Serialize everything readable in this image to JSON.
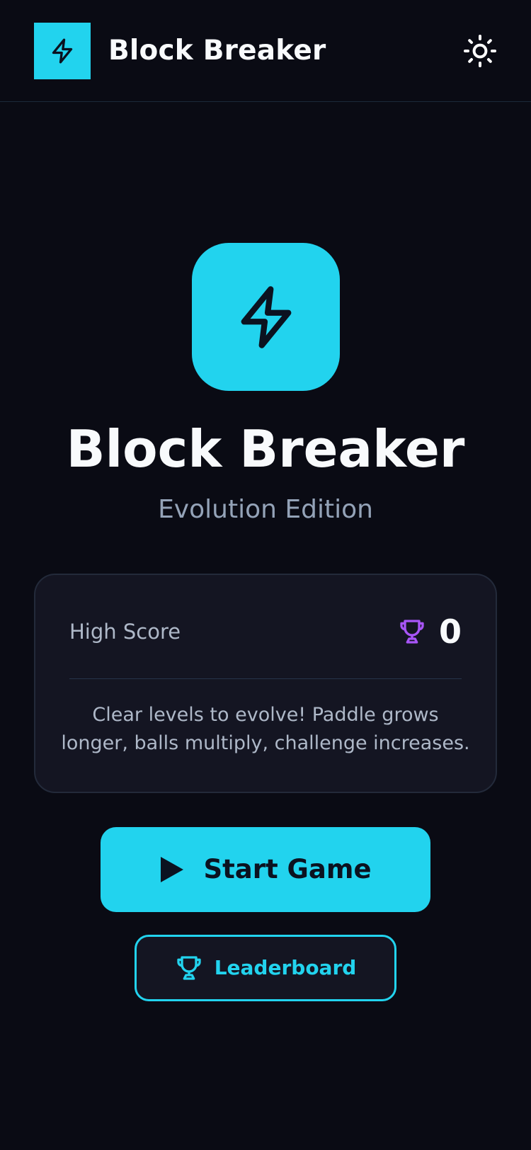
{
  "header": {
    "title": "Block Breaker",
    "logo_icon": "zap-icon",
    "theme_toggle_icon": "sun-icon"
  },
  "hero": {
    "icon": "zap-icon",
    "title": "Block Breaker",
    "subtitle": "Evolution Edition"
  },
  "score_card": {
    "label": "High Score",
    "trophy_icon": "trophy-icon",
    "value": "0",
    "description": "Clear levels to evolve! Paddle grows longer, balls multiply, challenge increases."
  },
  "actions": {
    "start_icon": "play-icon",
    "start_label": "Start Game",
    "leaderboard_icon": "trophy-icon",
    "leaderboard_label": "Leaderboard"
  },
  "colors": {
    "background": "#0a0b14",
    "accent": "#22d3ee",
    "card": "#141522",
    "trophy_purple": "#a855f7",
    "text_primary": "#f8fafc",
    "text_muted": "#94a3b8"
  }
}
